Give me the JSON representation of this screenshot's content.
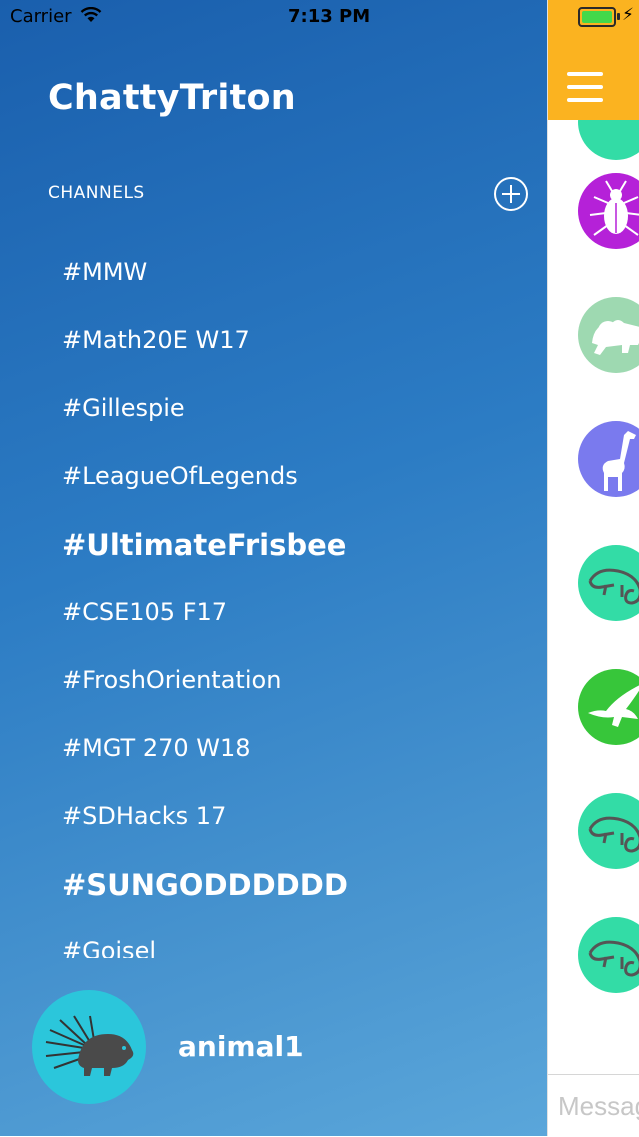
{
  "status_bar": {
    "carrier": "Carrier",
    "time": "7:13 PM",
    "battery_color": "#44d84a"
  },
  "drawer": {
    "app_title": "ChattyTriton",
    "channels_header": "CHANNELS",
    "add_channel_icon": "plus-circle-icon",
    "channels": [
      {
        "label": "#MMW",
        "bold": false
      },
      {
        "label": "#Math20E W17",
        "bold": false
      },
      {
        "label": "#Gillespie",
        "bold": false
      },
      {
        "label": "#LeagueOfLegends",
        "bold": false
      },
      {
        "label": "#UltimateFrisbee",
        "bold": true
      },
      {
        "label": "#CSE105 F17",
        "bold": false
      },
      {
        "label": "#FroshOrientation",
        "bold": false
      },
      {
        "label": "#MGT 270 W18",
        "bold": false
      },
      {
        "label": "#SDHacks 17",
        "bold": false
      },
      {
        "label": "#SUNGODDDDDD",
        "bold": true
      },
      {
        "label": "#Goisel",
        "bold": false
      }
    ],
    "user": {
      "name": "animal1",
      "avatar_icon": "porcupine-icon",
      "avatar_color": "#2bc6db"
    }
  },
  "chat": {
    "topbar_color": "#fbb320",
    "menu_icon": "hamburger-menu-icon",
    "avatars": [
      {
        "icon": "beetle-icon",
        "color": "#b521d8"
      },
      {
        "icon": "lion-icon",
        "color": "#9ed9b1"
      },
      {
        "icon": "giraffe-icon",
        "color": "#7a7aee"
      },
      {
        "icon": "chameleon-icon",
        "color": "#33dca6"
      },
      {
        "icon": "eagle-icon",
        "color": "#37c63a"
      },
      {
        "icon": "chameleon-icon",
        "color": "#33dca6"
      },
      {
        "icon": "chameleon-icon",
        "color": "#33dca6"
      }
    ],
    "message_placeholder": "Message"
  }
}
